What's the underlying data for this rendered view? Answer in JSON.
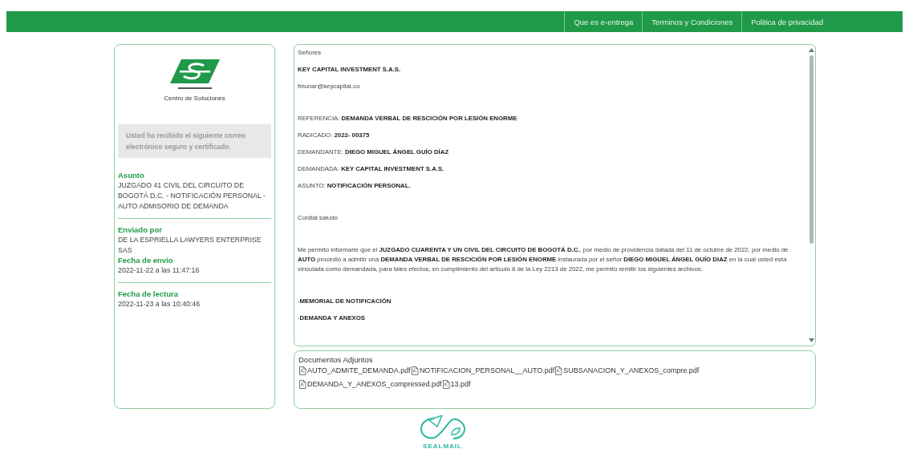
{
  "nav": [
    "Que es e-entrega",
    "Terminos y Condiciones",
    "Politica de privacidad"
  ],
  "sidebar": {
    "logo_caption": "Centro de Soluciones",
    "notice": "Usted ha recibido el siguiente correo electrónico seguro y certificado.",
    "groups": [
      [
        {
          "label": "Asunto",
          "value": "JUZGADO 41 CIVIL DEL CIRCUITO DE BOGOTÁ D.C. - NOTIFICACIÓN PERSONAL - AUTO ADMISORIO DE DEMANDA"
        }
      ],
      [
        {
          "label": "Enviado por",
          "value": "DE LA ESPRIELLA LAWYERS ENTERPRISE SAS"
        },
        {
          "label": "Fecha de envio",
          "value": "2022-11-22 a las 11:47:16"
        }
      ],
      [
        {
          "label": "Fecha de lectura",
          "value": "2022-11-23 a las 10:40:46"
        }
      ]
    ]
  },
  "message": {
    "blocks": [
      [
        "Señores",
        "**KEY CAPITAL INVESTMENT S.A.S.**",
        "fmunar@keycapital.co"
      ],
      [
        "REFERENCIA: **DEMANDA VERBAL DE RESCICIÓN POR LESIÓN ENORME**",
        "RADICADO: **2022- 00375**",
        "DEMANDANTE: **DIEGO MIGUEL ÁNGEL GUÍO DÍAZ**",
        "DEMANDADA: **KEY CAPITAL INVESTMENT S.A.S.**",
        "ASUNTO: **NOTIFICACIÓN PERSONAL.**"
      ],
      [
        "Cordial saludo"
      ],
      [
        "Me permito informarle que el **JUZGADO CUARENTA Y UN CIVIL DEL CIRCUITO DE BOGOTÁ D.C.**, por medio de providencia datada del 11 de octubre de 2022, por medio de **AUTO** procedió a admitir una **DEMANDA VERBAL DE RESCICIÓN POR LESIÓN ENORME** instaurada por el señor **DIEGO MIGUEL ÁNGEL GUÍO DIAZ** en la cual usted esta vinculada como demandada, para tales efectos, en cumplimiento del artículo 8 de la Ley 2213 de 2022, me permito remitir los siguientes archivos:"
      ],
      [
        "-**MEMORIAL DE NOTIFICACIÓN**",
        "-**DEMANDA Y ANEXOS**"
      ]
    ]
  },
  "attachments": {
    "title": "Documentos Adjuntos",
    "files": [
      "AUTO_ADMITE_DEMANDA.pdf",
      "NOTIFICACION_PERSONAL__AUTO.pdf",
      "SUBSANACION_Y_ANEXOS_compre.pdf",
      "DEMANDA_Y_ANEXOS_compressed.pdf",
      "13.pdf"
    ]
  },
  "footer": {
    "logo_text": "SEALMAIL"
  }
}
